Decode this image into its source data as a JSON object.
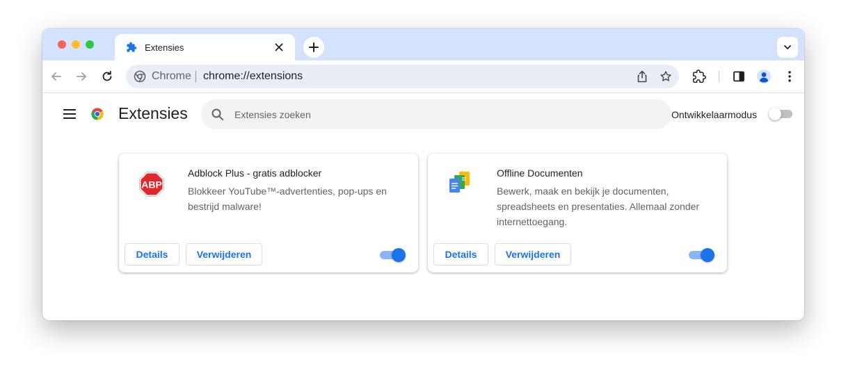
{
  "tab": {
    "title": "Extensies"
  },
  "omnibox": {
    "chip": "Chrome",
    "url": "chrome://extensions"
  },
  "page": {
    "title": "Extensies",
    "search_placeholder": "Extensies zoeken",
    "dev_mode_label": "Ontwikkelaarmodus",
    "dev_mode_enabled": false
  },
  "extensions": [
    {
      "name": "Adblock Plus - gratis adblocker",
      "description": "Blokkeer YouTube™-advertenties, pop-ups en bestrijd malware!",
      "details_label": "Details",
      "remove_label": "Verwijderen",
      "enabled": true,
      "icon": "abp-stop-sign-icon",
      "icon_text": "ABP"
    },
    {
      "name": "Offline Documenten",
      "description": "Bewerk, maak en bekijk je documenten, spreadsheets en presentaties. Allemaal zonder internettoegang.",
      "details_label": "Details",
      "remove_label": "Verwijderen",
      "enabled": true,
      "icon": "google-docs-icon"
    }
  ],
  "colors": {
    "tabstrip": "#d3e3fd",
    "omnibox": "#e9eef6",
    "accent": "#1a73e8",
    "abp_red": "#e3262b"
  }
}
